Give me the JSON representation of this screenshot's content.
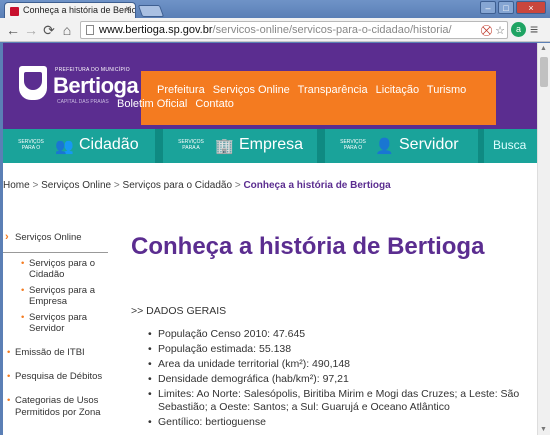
{
  "browser": {
    "tab_title": "Conheça a história de Bertio",
    "tab_close": "×",
    "url_host": "www.bertioga.sp.gov.br",
    "url_path": "/servicos-online/servicos-para-o-cidadao/historia/",
    "nav": {
      "back": "←",
      "forward": "→",
      "reload": "⟳",
      "home": "⌂"
    },
    "window": {
      "minimize": "–",
      "maximize": "□",
      "close": "×"
    },
    "ext_label": "a",
    "menu": "≡",
    "url_icons": {
      "blocked": "⛒",
      "star": "☆"
    }
  },
  "site": {
    "logo": {
      "small": "PREFEITURA DO MUNICÍPIO",
      "name": "Bertioga",
      "tag": "CAPITAL DAS PRAIAS"
    },
    "top_nav": [
      "Prefeitura",
      "Serviços Online",
      "Transparência",
      "Licitação",
      "Turismo"
    ],
    "top_nav_row2": [
      "Boletim Oficial",
      "Contato"
    ],
    "portals": [
      {
        "pre": "SERVIÇOS PARA O",
        "name": "Cidadão",
        "icon": "👥"
      },
      {
        "pre": "SERVIÇOS PARA A",
        "name": "Empresa",
        "icon": "🏢"
      },
      {
        "pre": "SERVIÇOS PARA O",
        "name": "Servidor",
        "icon": "👤"
      }
    ],
    "search_label": "Busca"
  },
  "breadcrumb": {
    "items": [
      "Home",
      "Serviços Online",
      "Serviços para o Cidadão"
    ],
    "current": "Conheça a história de Bertioga",
    "separator": ">"
  },
  "sidebar": {
    "main": "Serviços Online",
    "subs": [
      "Serviços para o Cidadão",
      "Serviços para a Empresa",
      "Serviços para Servidor"
    ],
    "items": [
      "Emissão de ITBI",
      "Pesquisa de Débitos",
      "Categorias de Usos Permitidos por Zona"
    ]
  },
  "content": {
    "title": "Conheça a história de Bertioga",
    "section": ">> DADOS GERAIS",
    "facts": [
      "População Censo 2010: 47.645",
      "População estimada: 55.138",
      "Area da unidade territorial (km²): 490,148",
      "Densidade demográfica (hab/km²): 97,21",
      "Limites: Ao Norte: Salesópolis, Biritiba Mirim e Mogi das Cruzes; a Leste: São Sebastião; a Oeste: Santos; a Sul: Guarujá e Oceano Atlântico",
      "Gentílico: bertioguense"
    ]
  },
  "colors": {
    "purple": "#5b2d90",
    "orange": "#f47b20",
    "teal": "#1aa39a"
  }
}
